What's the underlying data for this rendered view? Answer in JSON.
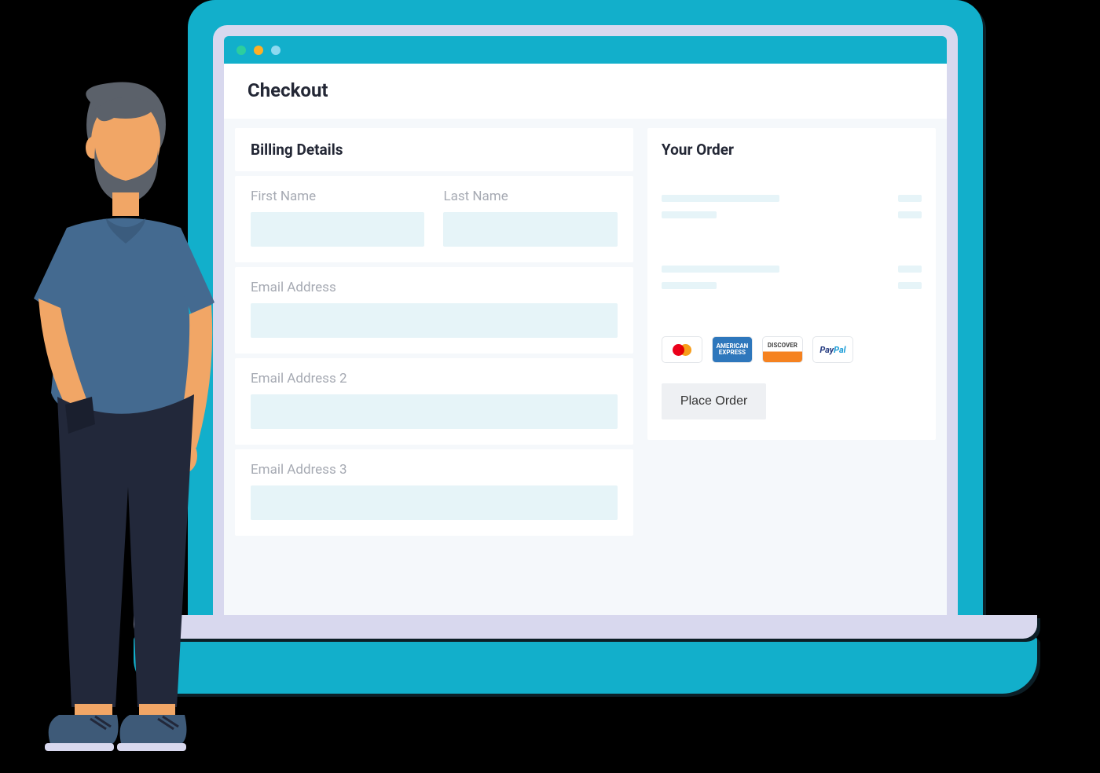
{
  "page": {
    "title": "Checkout"
  },
  "billing": {
    "header": "Billing Details",
    "fields": {
      "first_name_label": "First Name",
      "last_name_label": "Last Name",
      "email_label": "Email Address",
      "email2_label": "Email Address 2",
      "email3_label": "Email Address 3"
    }
  },
  "order": {
    "header": "Your Order",
    "place_order_label": "Place Order",
    "payment_methods": [
      "mastercard",
      "amex",
      "discover",
      "paypal"
    ]
  },
  "colors": {
    "brand_teal": "#12AFCB",
    "panel_bg": "#F5F8FB",
    "input_bg": "#E6F4F8",
    "lavender": "#D8D8EE"
  }
}
